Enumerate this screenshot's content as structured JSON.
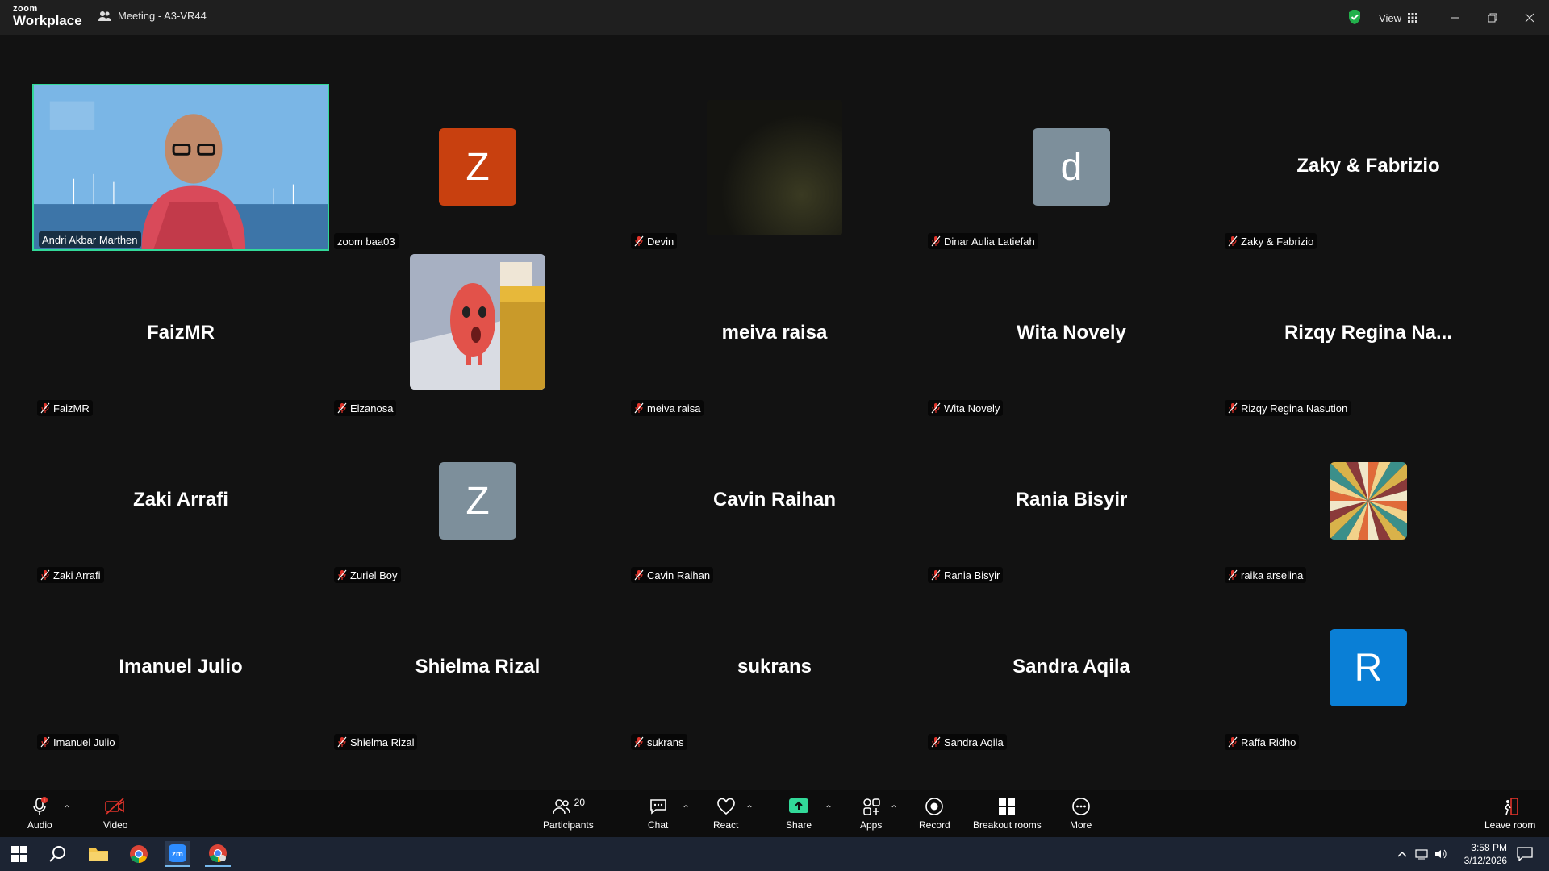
{
  "app": {
    "brand_top": "zoom",
    "brand_bottom": "Workplace",
    "meeting_title": "Meeting - A3-VR44",
    "view_label": "View"
  },
  "participants": [
    {
      "display": "video",
      "label": "Andri Akbar Marthen",
      "muted": false,
      "active": true
    },
    {
      "display": "avatar",
      "letter": "Z",
      "color": "#c8400f",
      "label": "zoom baa03",
      "muted": false
    },
    {
      "display": "video-dark",
      "label": "Devin",
      "muted": true
    },
    {
      "display": "avatar",
      "letter": "d",
      "color": "#7d8f9b",
      "label": "Dinar Aulia Latiefah",
      "muted": true
    },
    {
      "display": "name",
      "big": "Zaky & Fabrizio",
      "label": "Zaky & Fabrizio",
      "muted": true
    },
    {
      "display": "name",
      "big": "FaizMR",
      "label": "FaizMR",
      "muted": true
    },
    {
      "display": "video-game",
      "label": "Elzanosa",
      "muted": true
    },
    {
      "display": "name",
      "big": "meiva raisa",
      "label": "meiva raisa",
      "muted": true
    },
    {
      "display": "name",
      "big": "Wita Novely",
      "label": "Wita Novely",
      "muted": true
    },
    {
      "display": "name",
      "big": "Rizqy Regina Na...",
      "label": "Rizqy Regina Nasution",
      "muted": true
    },
    {
      "display": "name",
      "big": "Zaki Arrafi",
      "label": "Zaki Arrafi",
      "muted": true
    },
    {
      "display": "avatar",
      "letter": "Z",
      "color": "#7d8f9b",
      "label": "Zuriel Boy",
      "muted": true
    },
    {
      "display": "name",
      "big": "Cavin Raihan",
      "label": "Cavin Raihan",
      "muted": true
    },
    {
      "display": "name",
      "big": "Rania Bisyir",
      "label": "Rania Bisyir",
      "muted": true
    },
    {
      "display": "avatar-pattern",
      "label": "raika arselina",
      "muted": true
    },
    {
      "display": "name",
      "big": "Imanuel Julio",
      "label": "Imanuel Julio",
      "muted": true
    },
    {
      "display": "name",
      "big": "Shielma Rizal",
      "label": "Shielma Rizal",
      "muted": true
    },
    {
      "display": "name",
      "big": "sukrans",
      "label": "sukrans",
      "muted": true
    },
    {
      "display": "name",
      "big": "Sandra Aqila",
      "label": "Sandra Aqila",
      "muted": true
    },
    {
      "display": "avatar",
      "letter": "R",
      "color": "#0a7fd6",
      "label": "Raffa Ridho",
      "muted": true
    }
  ],
  "toolbar": {
    "audio": "Audio",
    "video": "Video",
    "participants": "Participants",
    "participants_count": "20",
    "chat": "Chat",
    "react": "React",
    "share": "Share",
    "apps": "Apps",
    "record": "Record",
    "breakout": "Breakout rooms",
    "more": "More",
    "leave": "Leave room"
  },
  "taskbar": {
    "time": "3:58 PM",
    "date": "3/12/2026"
  },
  "colors": {
    "active_border": "#32d999",
    "share_green": "#32d999",
    "muted_red": "#e0332a"
  }
}
